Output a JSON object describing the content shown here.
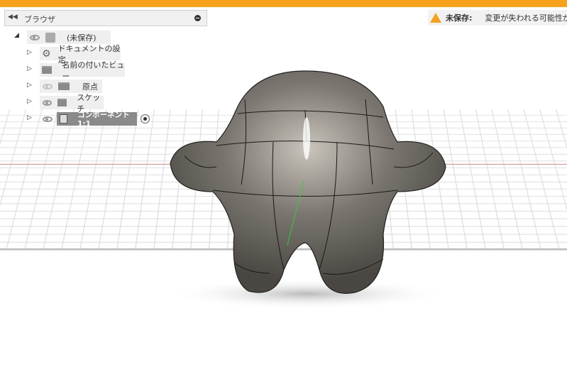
{
  "browser": {
    "title": "ブラウザ",
    "items": [
      {
        "label": "(未保存)"
      },
      {
        "label": "ドキュメントの設定"
      },
      {
        "label": "名前の付いたビュー"
      },
      {
        "label": "原点"
      },
      {
        "label": "スケッチ"
      },
      {
        "label": "コンポーネント1:1"
      }
    ]
  },
  "warning": {
    "label": "未保存:",
    "message": "変更が失われる可能性があります"
  },
  "colors": {
    "accent": "#f7a21b"
  }
}
